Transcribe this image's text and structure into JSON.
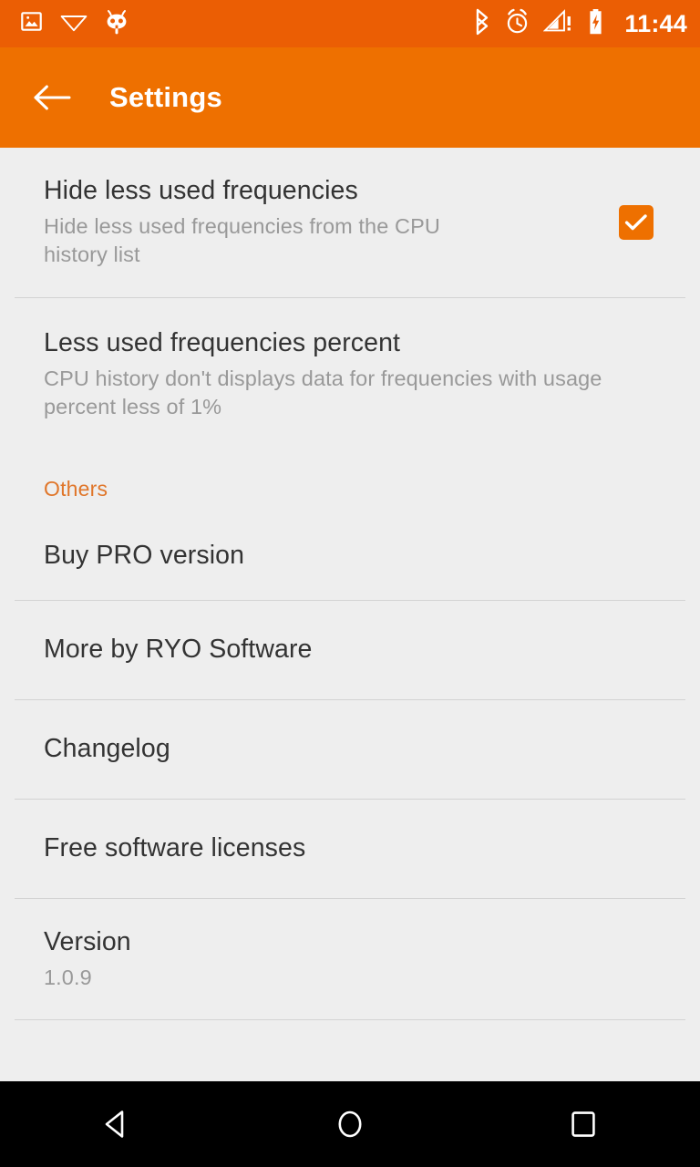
{
  "statusbar": {
    "time": "11:44",
    "left_icons": [
      "screenshot-icon",
      "wifi-icon",
      "cyanogenmod-icon"
    ],
    "right_icons": [
      "bluetooth-icon",
      "alarm-icon",
      "signal-no-service-icon",
      "battery-charging-icon"
    ],
    "background_color": "#EB5E04"
  },
  "toolbar": {
    "title": "Settings",
    "back_icon": "arrow-back-icon",
    "background_color": "#EE7000"
  },
  "theme": {
    "accent": "#EE7000",
    "section_header_color": "#E0762A",
    "page_background": "#EEEEEE",
    "divider": "#D3D3D3",
    "title_text": "#333333",
    "summary_text": "#999999"
  },
  "preferences": [
    {
      "name": "hide-less-used-frequencies",
      "title": "Hide less used frequencies",
      "summary": "Hide less used frequencies from the CPU history list",
      "widget": "checkbox",
      "checked": true
    },
    {
      "name": "less-used-frequencies-percent",
      "title": "Less used frequencies percent",
      "summary": "CPU history don't displays data for frequencies with usage percent less of 1%",
      "widget": "none"
    }
  ],
  "sections": [
    {
      "name": "others",
      "header": "Others",
      "items": [
        {
          "name": "buy-pro-version",
          "title": "Buy PRO version"
        },
        {
          "name": "more-by-ryo-software",
          "title": "More by RYO Software"
        },
        {
          "name": "changelog",
          "title": "Changelog"
        },
        {
          "name": "free-software-licenses",
          "title": "Free software licenses"
        },
        {
          "name": "version",
          "title": "Version",
          "summary": "1.0.9"
        }
      ]
    }
  ],
  "navbar": {
    "back_label": "back-nav",
    "home_label": "home-nav",
    "recents_label": "recents-nav"
  }
}
